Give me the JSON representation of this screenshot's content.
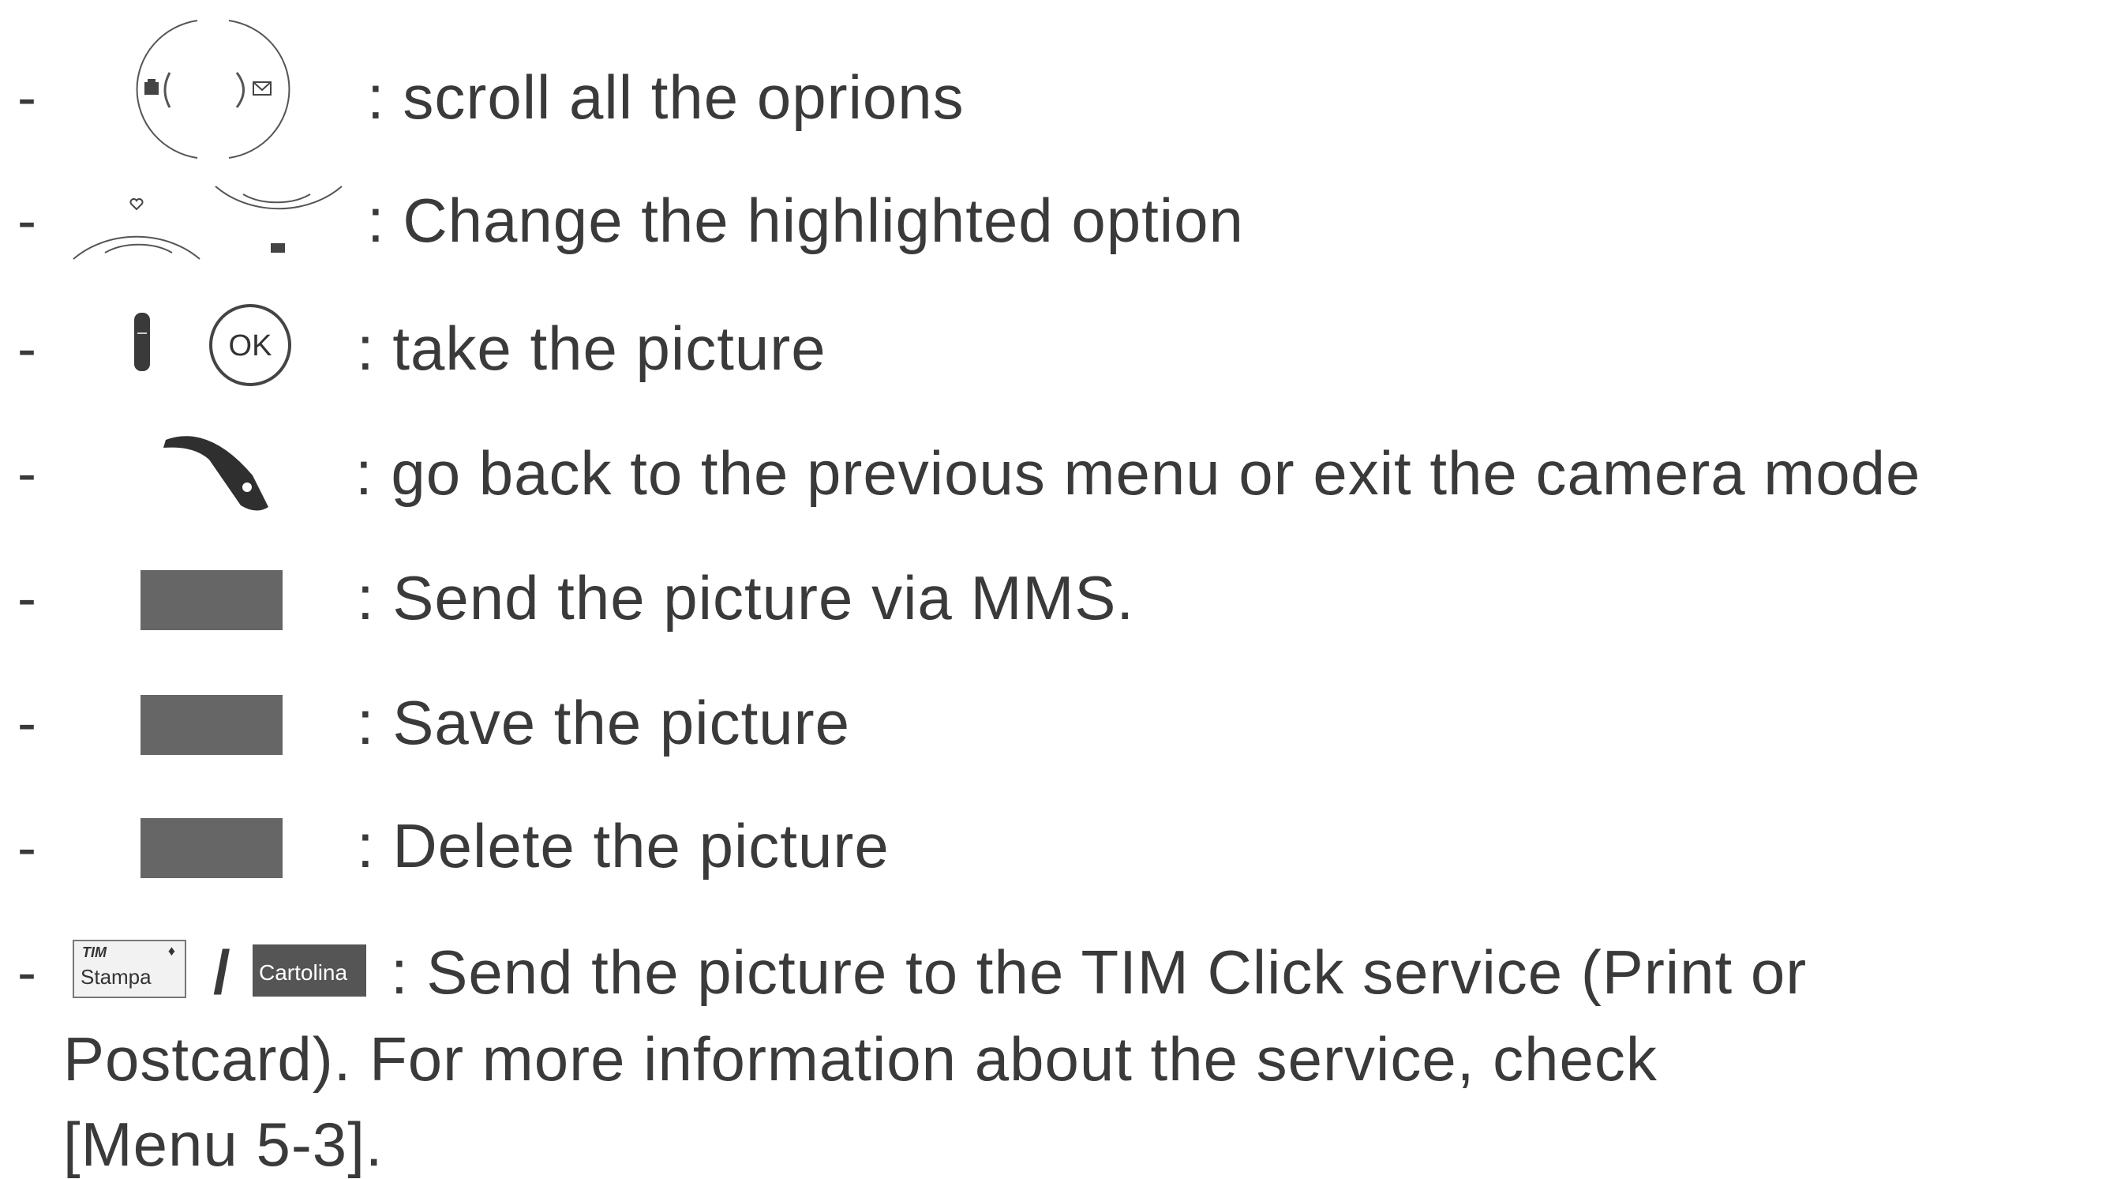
{
  "items": [
    {
      "text": ": scroll all the oprions",
      "icon": "left-right-nav-keys-icon"
    },
    {
      "text": ": Change the highlighted option",
      "icon": "up-down-nav-keys-icon"
    },
    {
      "text": ": take the picture",
      "icon": "side-key-and-ok-key-icon"
    },
    {
      "text": ": go back to the previous menu or exit the camera mode",
      "icon": "clear-key-icon"
    },
    {
      "text": ": Send the picture via MMS.",
      "icon": "soft-key-icon"
    },
    {
      "text": ": Save the picture",
      "icon": "soft-key-icon"
    },
    {
      "text": ": Delete the picture",
      "icon": "soft-key-icon"
    }
  ],
  "last_item": {
    "line1": ": Send the picture to the TIM Click service (Print or",
    "line2": "Postcard). For more information about the service, check",
    "line3": "[Menu 5-3].",
    "stampa_label_top": "TIM",
    "stampa_label": "Stampa",
    "separator": "/",
    "cartolina_label": "Cartolina"
  },
  "dash": "-",
  "ok_label": "OK",
  "colors": {
    "text": "#3a3a3a",
    "soft_key": "#666666"
  }
}
